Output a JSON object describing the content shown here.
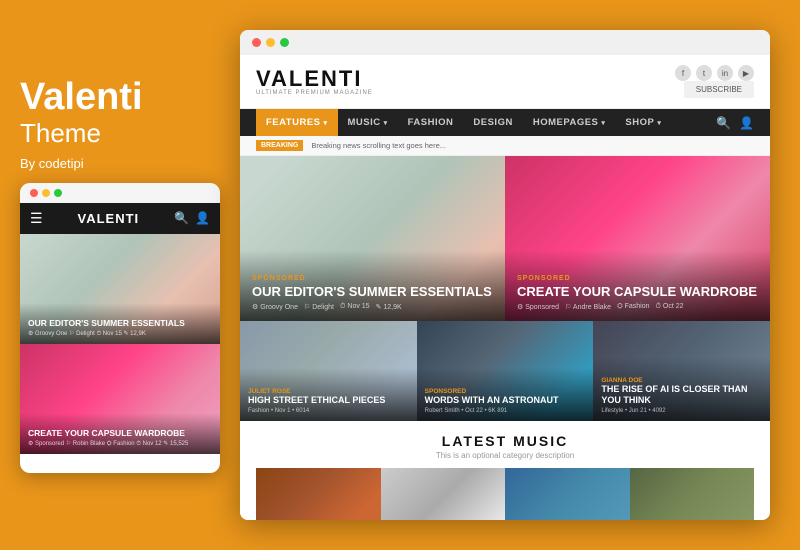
{
  "left": {
    "brand": "Valenti",
    "theme": "Theme",
    "byline": "By codetipi"
  },
  "mobile": {
    "dots": [
      "red",
      "yellow",
      "green"
    ],
    "navbar": {
      "logo": "VALENTI"
    },
    "card1": {
      "title": "OUR EDITOR'S SUMMER ESSENTIALS",
      "meta": "⚙ Groovy One  ⚐ Delight  ⏱ Nov 15  ✎ 12,9K"
    },
    "card2": {
      "title": "CREATE YOUR CAPSULE WARDROBE",
      "meta": "⚙ Sponsored  ⚐ Robin Blake  ⛭ Fashion  ⏱ Nov 12  ✎ 15,525"
    }
  },
  "browser": {
    "site_logo_main": "VALENTI",
    "site_logo_sub": "ULTIMATE PREMIUM MAGAZINE",
    "subscribe_label": "SUBSCRIBE",
    "nav": {
      "items": [
        {
          "label": "FEATURES",
          "active": true,
          "arrow": "▾"
        },
        {
          "label": "MUSIC",
          "active": false,
          "arrow": "▾"
        },
        {
          "label": "FASHION",
          "active": false
        },
        {
          "label": "DESIGN",
          "active": false
        },
        {
          "label": "HOMEPAGES",
          "active": false,
          "arrow": "▾"
        },
        {
          "label": "SHOP",
          "active": false,
          "arrow": "▾"
        }
      ]
    },
    "breaking": {
      "tag": "BREAKING",
      "text": "Breaking news scrolling text goes here..."
    },
    "card1": {
      "category": "SPONSORED",
      "title": "OUR EDITOR'S SUMMER ESSENTIALS",
      "meta": [
        "Groovy One",
        "Delight",
        "Nov 15",
        "12,9K"
      ]
    },
    "card2": {
      "category": "SPONSORED",
      "title": "CREATE YOUR CAPSULE WARDROBE",
      "meta": [
        "Sponsored",
        "Andre Blake",
        "Fashion",
        "Oct 22"
      ]
    },
    "mid_card1": {
      "category": "Juliet Rose",
      "title": "HIGH STREET ETHICAL PIECES",
      "meta": "Fashion  •  Nov 1  •  6014"
    },
    "mid_card2": {
      "category": "Sponsored",
      "title": "WORDS WITH AN ASTRONAUT",
      "meta": "Robert Smith  •  Oct 22  •  6K 891"
    },
    "mid_card3": {
      "category": "Gianna Doe",
      "title": "THE RISE OF AI IS CLOSER THAN YOU THINK",
      "meta": "Lifestyle  •  Jun 21  •  4092"
    },
    "latest_music": {
      "title": "LATEST MUSIC",
      "subtitle": "This is an optional category description"
    }
  }
}
